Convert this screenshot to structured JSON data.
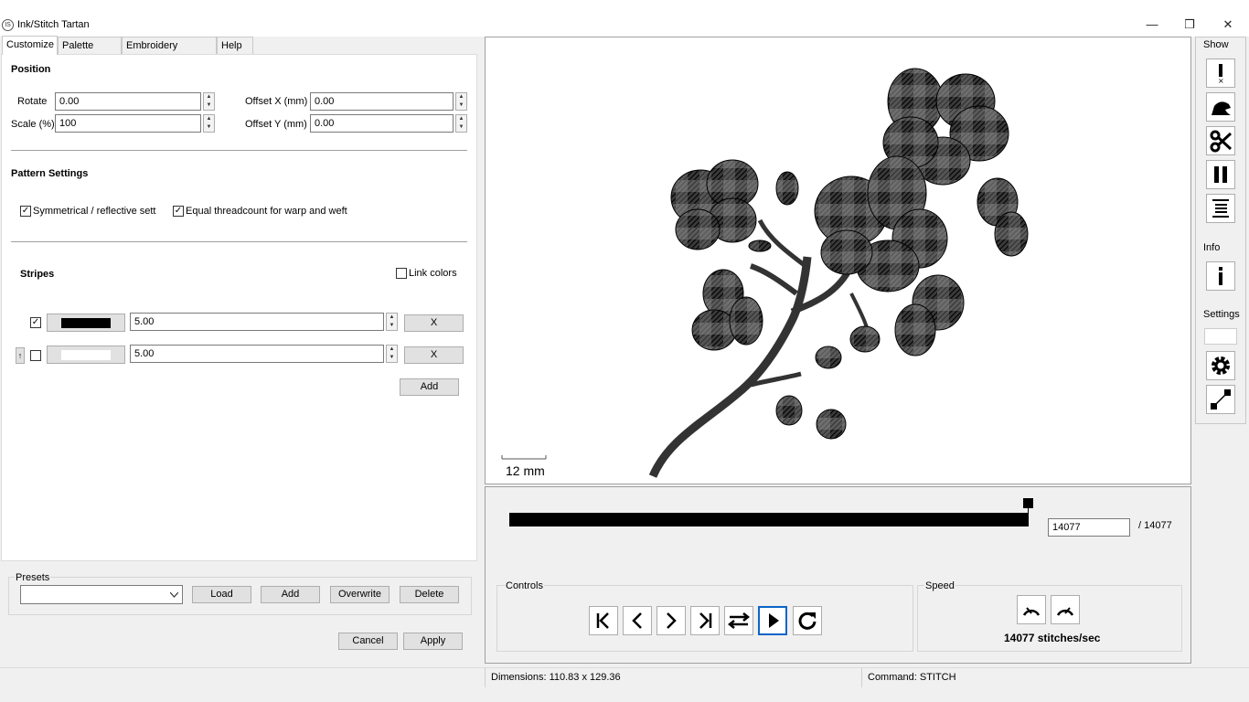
{
  "window": {
    "title": "Ink/Stitch Tartan",
    "minimize": "—",
    "restore": "❒",
    "close": "✕",
    "icon_text": "IS"
  },
  "tabs": [
    "Customize",
    "Palette Code",
    "Embroidery Settings",
    "Help"
  ],
  "position": {
    "title": "Position",
    "rotate_label": "Rotate",
    "rotate_value": "0.00",
    "scale_label": "Scale (%)",
    "scale_value": "100",
    "offset_x_label": "Offset X (mm)",
    "offset_x_value": "0.00",
    "offset_y_label": "Offset Y (mm)",
    "offset_y_value": "0.00"
  },
  "pattern": {
    "title": "Pattern Settings",
    "symmetrical_label": "Symmetrical / reflective sett",
    "symmetrical_checked": true,
    "equal_label": "Equal threadcount for warp and weft",
    "equal_checked": true
  },
  "stripes": {
    "title": "Stripes",
    "link_colors_label": "Link colors",
    "rows": [
      {
        "checked": true,
        "color": "#000000",
        "value": "5.00",
        "remove": "X"
      },
      {
        "checked": false,
        "color": "#ffffff",
        "value": "5.00",
        "remove": "X",
        "move": "↑"
      }
    ],
    "add_label": "Add"
  },
  "presets": {
    "title": "Presets",
    "selected": "",
    "load": "Load",
    "add": "Add",
    "overwrite": "Overwrite",
    "delete": "Delete"
  },
  "dialog": {
    "cancel": "Cancel",
    "apply": "Apply"
  },
  "canvas": {
    "scale_label": "12 mm"
  },
  "slider": {
    "current": "14077",
    "total": "/ 14077",
    "progress": 1.0
  },
  "controls": {
    "title": "Controls"
  },
  "speed": {
    "title": "Speed",
    "rate": "14077 stitches/sec"
  },
  "sidebar": {
    "show": "Show",
    "info": "Info",
    "settings": "Settings"
  },
  "status": {
    "dimensions": "Dimensions: 110.83 x 129.36",
    "command": "Command: STITCH"
  },
  "colors": {
    "accent": "#0a64c8",
    "swatch_black": "#000000",
    "swatch_white": "#ffffff"
  }
}
